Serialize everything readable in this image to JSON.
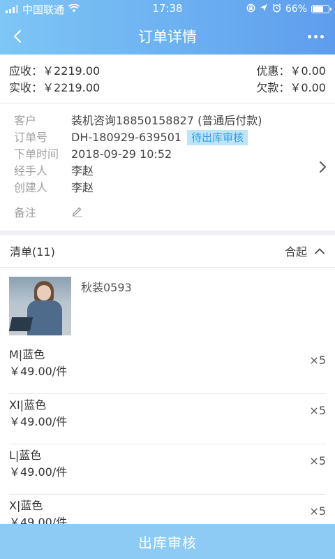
{
  "status_bar": {
    "carrier": "中国联通",
    "time": "17:38",
    "battery": "66%"
  },
  "nav": {
    "title": "订单详情"
  },
  "summary": {
    "receivable_label": "应收：",
    "receivable_value": "￥2219.00",
    "discount_label": "优惠：",
    "discount_value": "￥0.00",
    "received_label": "实收：",
    "received_value": "￥2219.00",
    "debt_label": "欠款：",
    "debt_value": "￥0.00"
  },
  "info": {
    "customer_label": "客户",
    "customer_value": "装机咨询18850158827 (普通后付款)",
    "order_no_label": "订单号",
    "order_no_value": "DH-180929-639501",
    "status_tag": "待出库审核",
    "order_time_label": "下单时间",
    "order_time_value": "2018-09-29 10:52",
    "handler_label": "经手人",
    "handler_value": "李赵",
    "creator_label": "创建人",
    "creator_value": "李赵",
    "note_label": "备注"
  },
  "list": {
    "title": "清单(11)",
    "collapse_label": "合起",
    "product_name": "秋装0593",
    "variants": [
      {
        "name": "M|蓝色",
        "price": "￥49.00/件",
        "qty": "×5"
      },
      {
        "name": "XI|蓝色",
        "price": "￥49.00/件",
        "qty": "×5"
      },
      {
        "name": "L|蓝色",
        "price": "￥49.00/件",
        "qty": "×5"
      },
      {
        "name": "X|蓝色",
        "price": "￥49.00/件",
        "qty": "×5"
      }
    ]
  },
  "bottom": {
    "action_label": "出库审核"
  },
  "colors": {
    "header_start": "#7ec6f5",
    "header_end": "#5e9ded",
    "tag_bg": "#bfe4f8",
    "tag_text": "#2b9fe0",
    "bottom_button": "#8dcaf4"
  }
}
